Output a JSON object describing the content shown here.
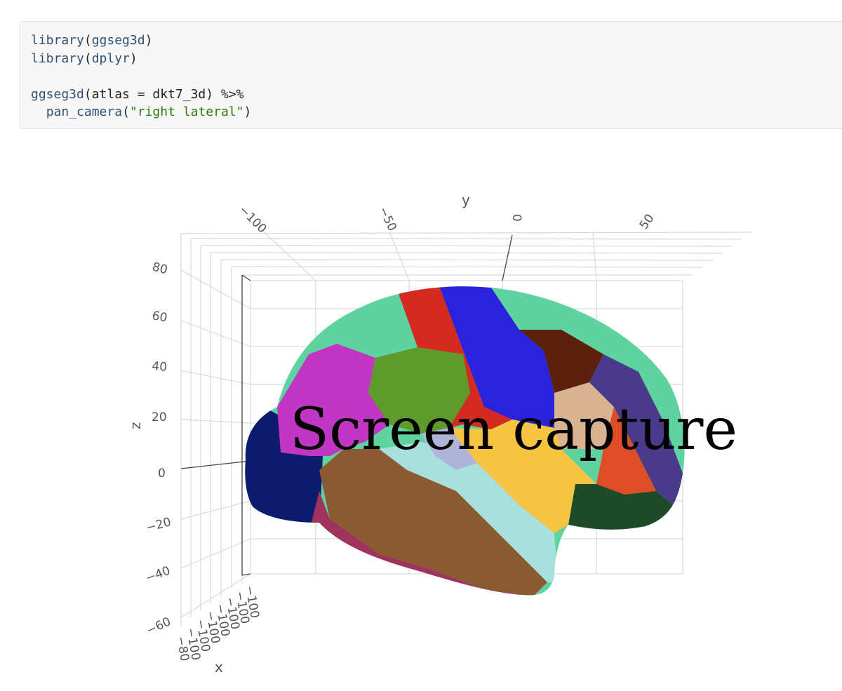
{
  "code": {
    "line1": {
      "fn": "library",
      "open": "(",
      "arg": "ggseg3d",
      "close": ")"
    },
    "line2": {
      "fn": "library",
      "open": "(",
      "arg": "dplyr",
      "close": ")"
    },
    "line4": {
      "fn": "ggseg3d",
      "text": "(atlas = dkt7_3d) %>%"
    },
    "line5": {
      "indent": "  ",
      "fn": "pan_camera",
      "open": "(",
      "str": "\"right lateral\"",
      "close": ")"
    }
  },
  "plot": {
    "overlay": "Screen capture",
    "axes": {
      "y_title": "y",
      "z_title": "z",
      "x_title": "x",
      "y_ticks": [
        "−100",
        "−50",
        "0",
        "50"
      ],
      "z_ticks": [
        "80",
        "60",
        "40",
        "20",
        "0",
        "−20",
        "−40",
        "−60"
      ],
      "x_ticks": [
        "−60",
        "−80",
        "−100",
        "−100",
        "−100",
        "−100",
        "−100",
        "−100",
        "−100"
      ]
    },
    "colors": {
      "grid": "#d9d9d9",
      "region_teal": "#5ed3a0",
      "region_red": "#d42a22",
      "region_blue": "#2a23db",
      "region_magenta": "#c236c4",
      "region_green": "#5f9b2b",
      "region_navy": "#0e1a6e",
      "region_brown": "#8c5a32",
      "region_cyan": "#a8e0de",
      "region_yellow": "#f7c442",
      "region_darkbrown": "#5b210c",
      "region_tan": "#d8b392",
      "region_purple": "#4a3a8c",
      "region_orange": "#de4d26",
      "region_darkgreen": "#1f4a2a",
      "region_plum": "#a0325e"
    }
  }
}
